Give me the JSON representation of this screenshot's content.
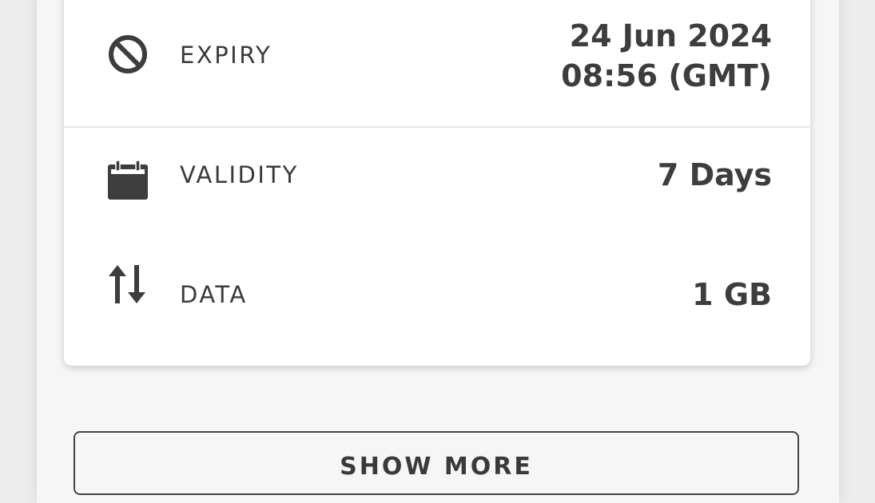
{
  "details": {
    "expiry": {
      "icon": "block-icon",
      "label": "EXPIRY",
      "value_line1": "24 Jun 2024",
      "value_line2": "08:56 (GMT)"
    },
    "validity": {
      "icon": "calendar-icon",
      "label": "VALIDITY",
      "value": "7 Days"
    },
    "data": {
      "icon": "swap-vertical-icon",
      "label": "DATA",
      "value": "1 GB"
    }
  },
  "actions": {
    "show_more_label": "SHOW MORE"
  },
  "colors": {
    "text": "#3a3a3a",
    "card_bg": "#ffffff",
    "panel_bg": "#f6f6f6",
    "divider": "#e6e6e6"
  }
}
